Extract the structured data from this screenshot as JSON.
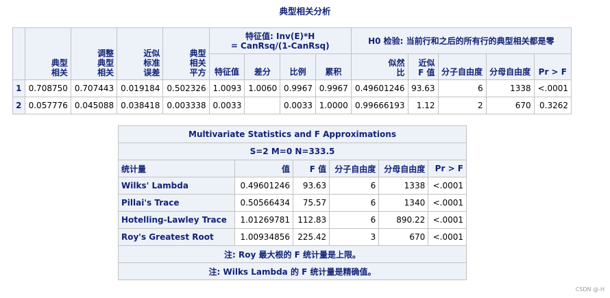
{
  "title": "典型相关分析",
  "table1": {
    "group_eigen": [
      "特征值: Inv(E)*H",
      "= CanRsq/(1-CanRsq)"
    ],
    "group_test": "H0 检验: 当前行和之后的所有行的典型相关都是零",
    "col_canonical_corr": [
      "典型",
      "相关"
    ],
    "col_adjusted": [
      "调整",
      "典型",
      "相关"
    ],
    "col_approx_se": [
      "近似",
      "标准",
      "误差"
    ],
    "col_squared": [
      "典型",
      "相关",
      "平方"
    ],
    "col_eigenvalue": "特征值",
    "col_difference": "差分",
    "col_proportion": "比例",
    "col_cumulative": "累积",
    "col_likelihood": [
      "似然",
      "比"
    ],
    "col_approx_f": [
      "近似",
      "F 值"
    ],
    "col_num_df": "分子自由度",
    "col_den_df": "分母自由度",
    "col_pr": "Pr > F",
    "rows": [
      {
        "idx": "1",
        "cc": "0.708750",
        "adj": "0.707443",
        "se": "0.019184",
        "sq": "0.502326",
        "eig": "1.0093",
        "diff": "1.0060",
        "prop": "0.9967",
        "cum": "0.9967",
        "lr": "0.49601246",
        "f": "93.63",
        "ndf": "6",
        "ddf": "1338",
        "pr": "<.0001"
      },
      {
        "idx": "2",
        "cc": "0.057776",
        "adj": "0.045088",
        "se": "0.038418",
        "sq": "0.003338",
        "eig": "0.0033",
        "diff": "",
        "prop": "0.0033",
        "cum": "1.0000",
        "lr": "0.99666193",
        "f": "1.12",
        "ndf": "2",
        "ddf": "670",
        "pr": "0.3262"
      }
    ]
  },
  "table2": {
    "heading": "Multivariate Statistics and F Approximations",
    "subheading": "S=2 M=0 N=333.5",
    "col_stat": "统计量",
    "col_value": "值",
    "col_f": "F 值",
    "col_num_df": "分子自由度",
    "col_den_df": "分母自由度",
    "col_pr": "Pr > F",
    "rows": [
      {
        "name": "Wilks' Lambda",
        "value": "0.49601246",
        "f": "93.63",
        "ndf": "6",
        "ddf": "1338",
        "pr": "<.0001"
      },
      {
        "name": "Pillai's Trace",
        "value": "0.50566434",
        "f": "75.57",
        "ndf": "6",
        "ddf": "1340",
        "pr": "<.0001"
      },
      {
        "name": "Hotelling-Lawley Trace",
        "value": "1.01269781",
        "f": "112.83",
        "ndf": "6",
        "ddf": "890.22",
        "pr": "<.0001"
      },
      {
        "name": "Roy's Greatest Root",
        "value": "1.00934856",
        "f": "225.42",
        "ndf": "3",
        "ddf": "670",
        "pr": "<.0001"
      }
    ],
    "note1": "注: Roy 最大根的 F 统计量是上限。",
    "note2": "注: Wilks Lambda 的 F 统计量是精确值。"
  },
  "watermark": "CSDN @-H"
}
